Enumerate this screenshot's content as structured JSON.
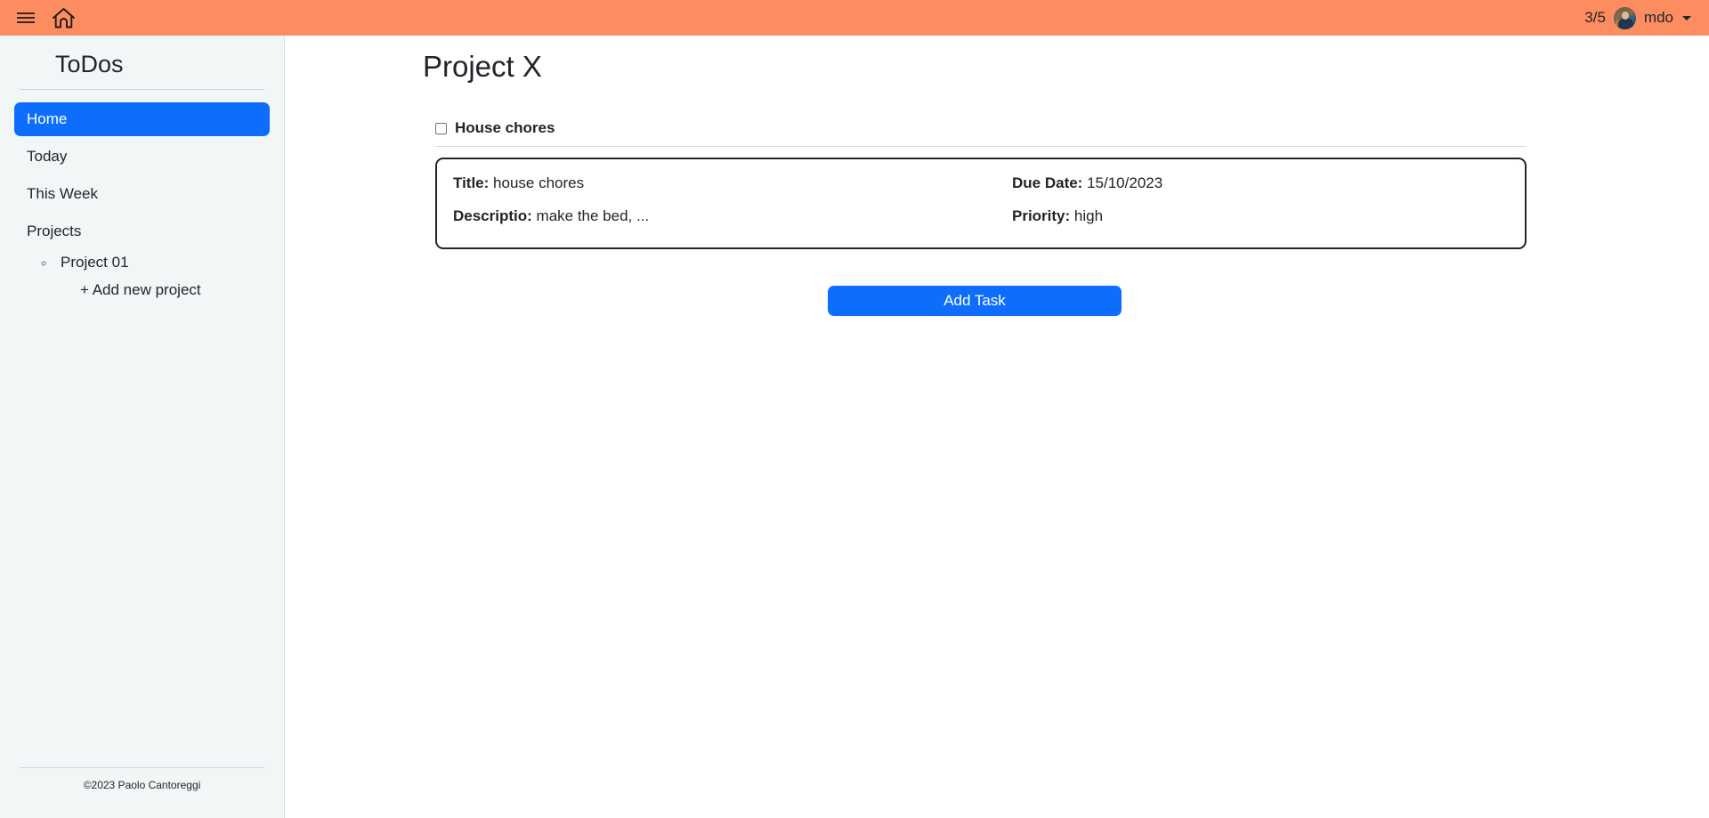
{
  "topbar": {
    "background_color": "#fd8c61",
    "menu_icon": "hamburger-menu-icon",
    "home_icon": "home-icon",
    "counter": "3/5",
    "avatar_icon": "user-avatar",
    "user_name": "mdo",
    "caret_icon": "caret-down-icon"
  },
  "sidebar": {
    "brand": "ToDos",
    "background_color": "#f1f7f6",
    "active_color": "#0d6efd",
    "items": [
      {
        "label": "Home",
        "active": true
      },
      {
        "label": "Today",
        "active": false
      },
      {
        "label": "This Week",
        "active": false
      },
      {
        "label": "Projects",
        "active": false
      }
    ],
    "projects": [
      {
        "label": "Project 01"
      }
    ],
    "add_project_label": "+ Add new project",
    "footer": "©2023 Paolo Cantoreggi"
  },
  "main": {
    "page_title": "Project X",
    "task": {
      "checkbox_checked": false,
      "name": "House chores",
      "fields": {
        "title_label": "Title:",
        "title_value": "house chores",
        "description_label": "Descriptio:",
        "description_value": "make the bed, ...",
        "due_date_label": "Due Date:",
        "due_date_value": "15/10/2023",
        "priority_label": "Priority:",
        "priority_value": "high"
      }
    },
    "add_task_label": "Add Task"
  }
}
